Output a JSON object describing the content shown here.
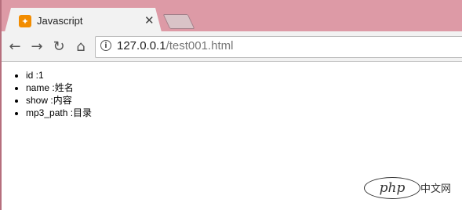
{
  "browser": {
    "tab": {
      "favicon_glyph": "✦",
      "title": "Javascript",
      "close_glyph": "✕"
    },
    "nav": {
      "back_glyph": "←",
      "forward_glyph": "→",
      "reload_glyph": "↻",
      "home_glyph": "⌂"
    },
    "address": {
      "info_glyph": "i",
      "host": "127.0.0.1",
      "path": "/test001.html"
    }
  },
  "page": {
    "items": [
      {
        "key": "id",
        "sep": " :",
        "value": "1"
      },
      {
        "key": "name",
        "sep": " :",
        "value": "姓名"
      },
      {
        "key": "show",
        "sep": " :",
        "value": "内容"
      },
      {
        "key": "mp3_path",
        "sep": " :",
        "value": "目录"
      }
    ]
  },
  "watermark": {
    "logo_text": "php",
    "site_text": "中文网"
  },
  "colors": {
    "window_frame": "#dd9aa6",
    "favicon_bg": "#f28c00",
    "toolbar_bg": "#f2f2f2"
  }
}
